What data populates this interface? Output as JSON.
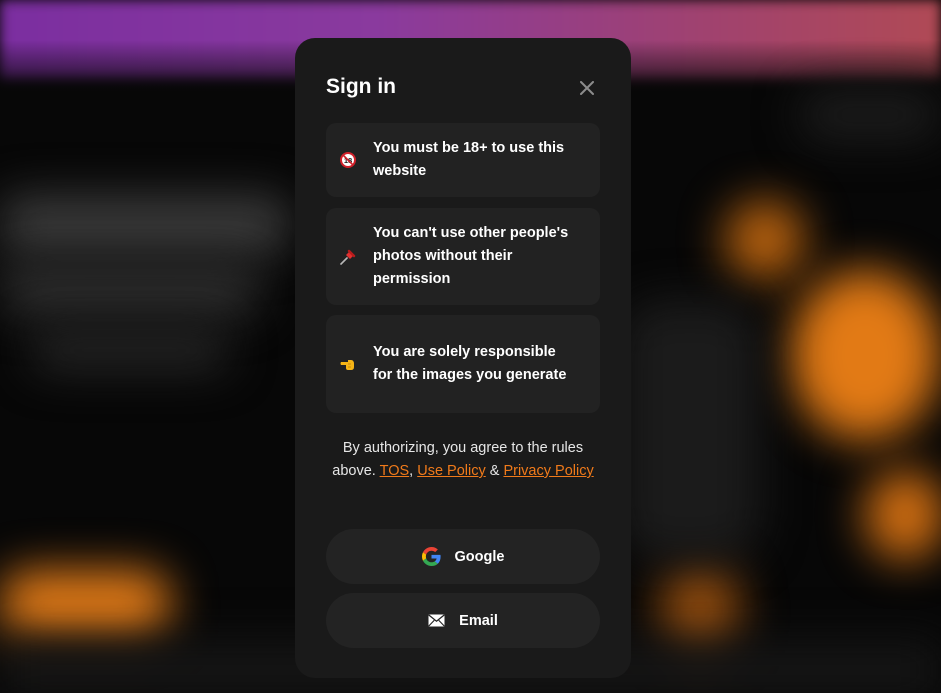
{
  "modal": {
    "title": "Sign in",
    "close_icon": "close-icon"
  },
  "rules": [
    {
      "icon": "no-under-18-icon",
      "text": "You must be 18+ to use this website"
    },
    {
      "icon": "pushpin-icon",
      "text": "You can't use other people's photos without their permission"
    },
    {
      "icon": "pointing-hand-icon",
      "text": "You are solely responsible for the images you generate"
    }
  ],
  "agreement": {
    "prefix": "By authorizing, you agree to the rules above.",
    "tos": "TOS",
    "comma": ",",
    "use_policy": "Use Policy",
    "amp": "&",
    "privacy_policy": "Privacy Policy"
  },
  "buttons": {
    "google": {
      "icon": "google-icon",
      "label": "Google"
    },
    "email": {
      "icon": "envelope-icon",
      "label": "Email"
    }
  },
  "colors": {
    "modal_bg": "#1a1a1a",
    "card_bg": "#222222",
    "link": "#f07a1a",
    "header_gradient_start": "#7b2ea0",
    "header_gradient_end": "#b04a55"
  }
}
